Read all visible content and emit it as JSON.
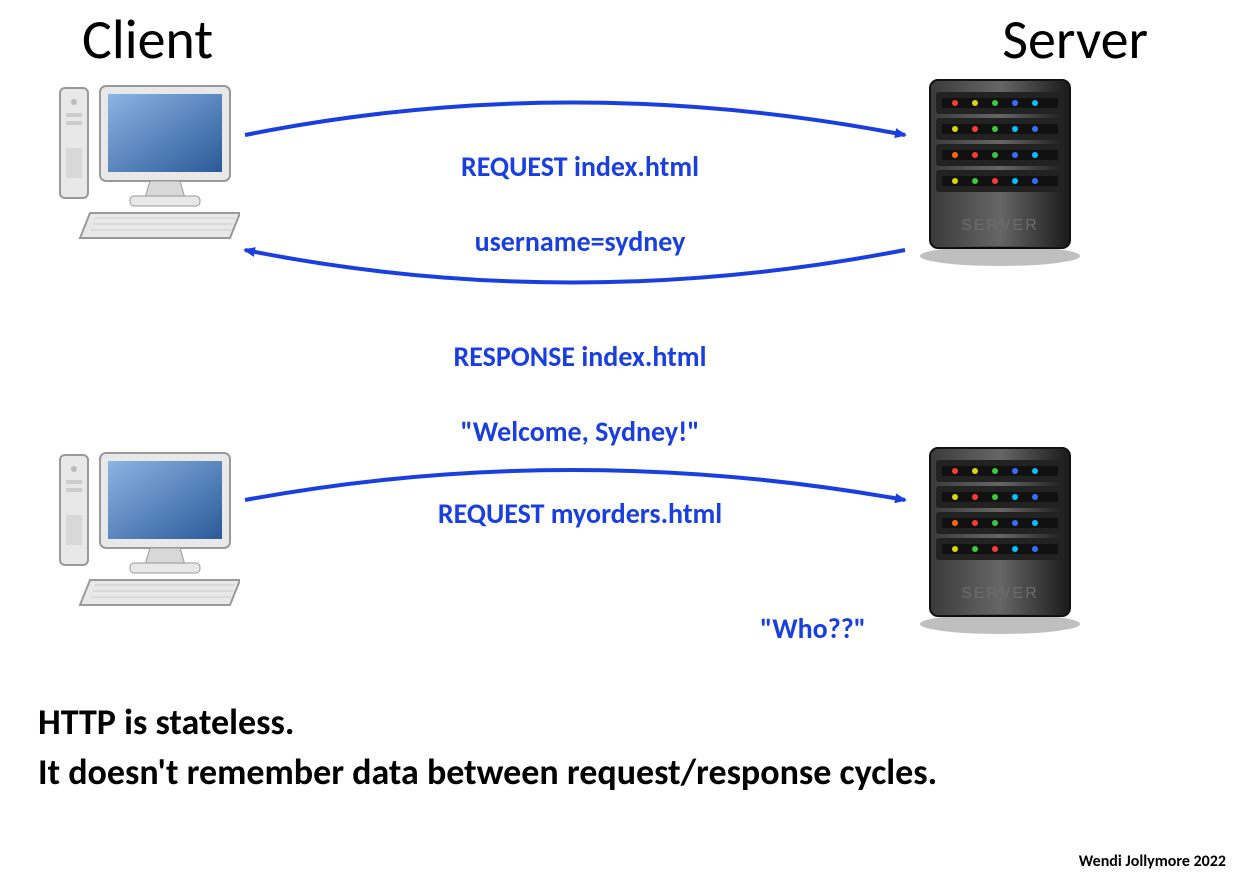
{
  "headings": {
    "client": "Client",
    "server": "Server"
  },
  "messages": {
    "req1_line1": "REQUEST index.html",
    "req1_line2": "username=sydney",
    "resp1_line1": "RESPONSE index.html",
    "resp1_line2": "\"Welcome, Sydney!\"",
    "req2": "REQUEST myorders.html",
    "who": "\"Who??\""
  },
  "caption": {
    "line1": "HTTP is stateless.",
    "line2": "It doesn't remember data between request/response cycles."
  },
  "attribution": "Wendi Jollymore 2022",
  "colors": {
    "arrow": "#1a3fe0",
    "text_msg": "#1a3fe0"
  }
}
